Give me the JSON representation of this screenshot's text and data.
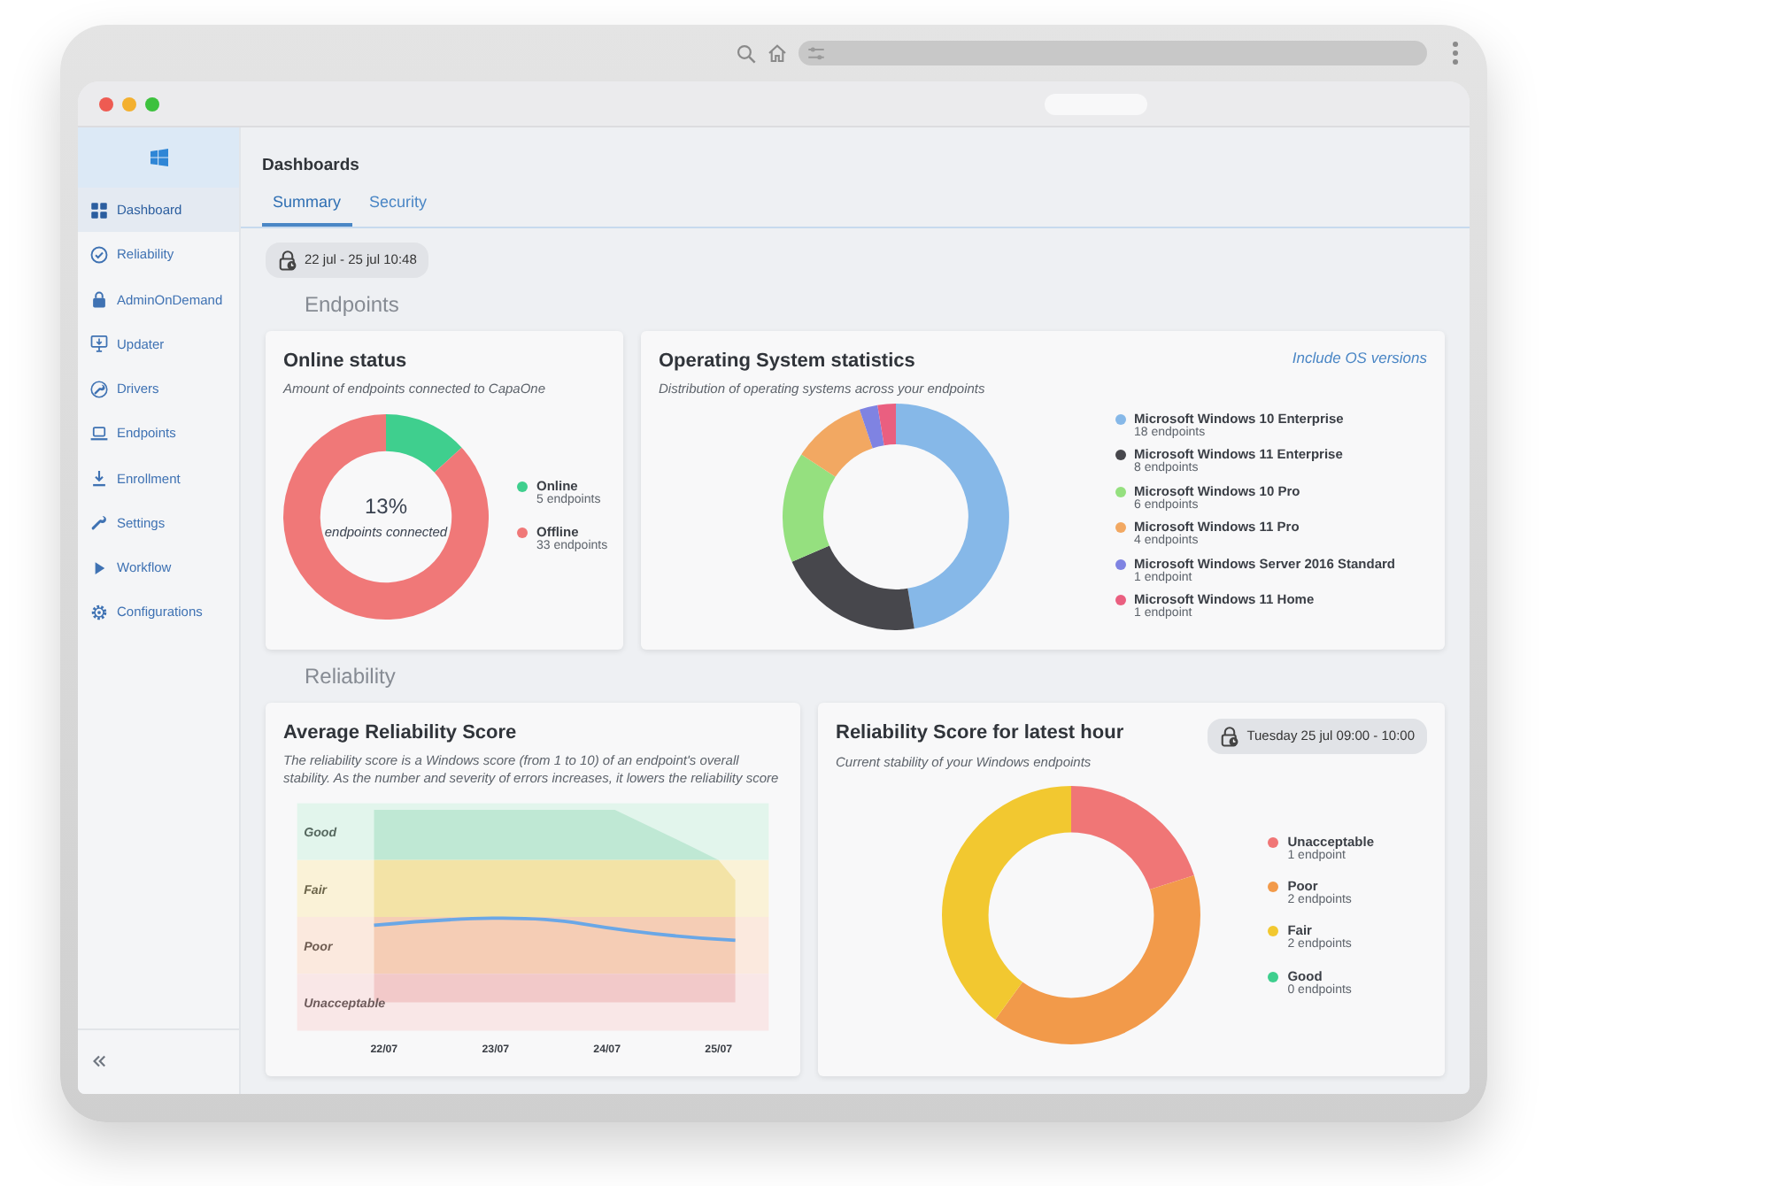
{
  "sidebar": {
    "items": [
      {
        "label": "Dashboard",
        "selected": true
      },
      {
        "label": "Reliability",
        "selected": false
      },
      {
        "label": "AdminOnDemand",
        "selected": false
      },
      {
        "label": "Updater",
        "selected": false
      },
      {
        "label": "Drivers",
        "selected": false
      },
      {
        "label": "Endpoints",
        "selected": false
      },
      {
        "label": "Enrollment",
        "selected": false
      },
      {
        "label": "Settings",
        "selected": false
      },
      {
        "label": "Workflow",
        "selected": false
      },
      {
        "label": "Configurations",
        "selected": false
      }
    ]
  },
  "header": {
    "title": "Dashboards",
    "tabs": [
      {
        "label": "Summary",
        "selected": true
      },
      {
        "label": "Security",
        "selected": false
      }
    ]
  },
  "date_range": "22 jul - 25 jul 10:48",
  "endpoints": {
    "heading": "Endpoints",
    "online_status": {
      "title": "Online status",
      "subtitle": "Amount of endpoints connected to CapaOne",
      "center_value": "13%",
      "center_label": "endpoints connected",
      "chart_data": {
        "type": "donut",
        "categories": [
          "Online",
          "Offline"
        ],
        "values": [
          13.2,
          86.8
        ]
      },
      "legend": [
        {
          "count": "5 endpoints",
          "color": "#3fcf8e"
        },
        {
          "count": "33 endpoints",
          "color": "#f07878"
        }
      ]
    },
    "os_statistics": {
      "title": "Operating System statistics",
      "subtitle": "Distribution of operating systems across your endpoints",
      "link": "Include OS versions",
      "chart_data": {
        "type": "donut",
        "categories": [
          "Microsoft Windows 10 Enterprise",
          "Microsoft Windows 11 Enterprise",
          "Microsoft Windows 10 Pro",
          "Microsoft Windows 11 Pro",
          "Microsoft Windows Server 2016 Standard",
          "Microsoft Windows 11 Home"
        ],
        "values": [
          47.4,
          21.1,
          15.8,
          10.5,
          2.6,
          2.6
        ]
      },
      "legend": [
        {
          "count": "18 endpoints",
          "color": "#86b8e8"
        },
        {
          "count": "8 endpoints",
          "color": "#47474c"
        },
        {
          "count": "6 endpoints",
          "color": "#95e07f"
        },
        {
          "count": "4 endpoints",
          "color": "#f2a862"
        },
        {
          "count": "1 endpoint",
          "color": "#7f83e2"
        },
        {
          "count": "1 endpoint",
          "color": "#ea5f80"
        }
      ]
    }
  },
  "reliability": {
    "heading": "Reliability",
    "average_score": {
      "title": "Average Reliability Score",
      "description": "The reliability score is a Windows score (from 1 to 10) of an endpoint's overall stability. As the number and severity of errors increases, it lowers the reliability score",
      "bands": [
        {
          "label": "Good",
          "color": "#bfe8d4"
        },
        {
          "label": "Fair",
          "color": "#f3e3a6"
        },
        {
          "label": "Poor",
          "color": "#f5cdb5"
        },
        {
          "label": "Unacceptable",
          "color": "#f2c9c9"
        }
      ],
      "x_labels": [
        "22/07",
        "23/07",
        "24/07",
        "25/07"
      ]
    },
    "latest_hour": {
      "title": "Reliability Score for latest hour",
      "subtitle": "Current stability of your Windows endpoints",
      "period": "Tuesday 25 jul 09:00 - 10:00",
      "chart_data": {
        "type": "donut",
        "categories": [
          "Unacceptable",
          "Poor",
          "Fair",
          "Good"
        ],
        "values": [
          20,
          40,
          40,
          0
        ]
      },
      "legend": [
        {
          "count": "1 endpoint",
          "color": "#f07676"
        },
        {
          "count": "2 endpoints",
          "color": "#f29a4a"
        },
        {
          "count": "2 endpoints",
          "color": "#f2c830"
        },
        {
          "count": "0 endpoints",
          "color": "#3ecf8e"
        }
      ]
    }
  }
}
